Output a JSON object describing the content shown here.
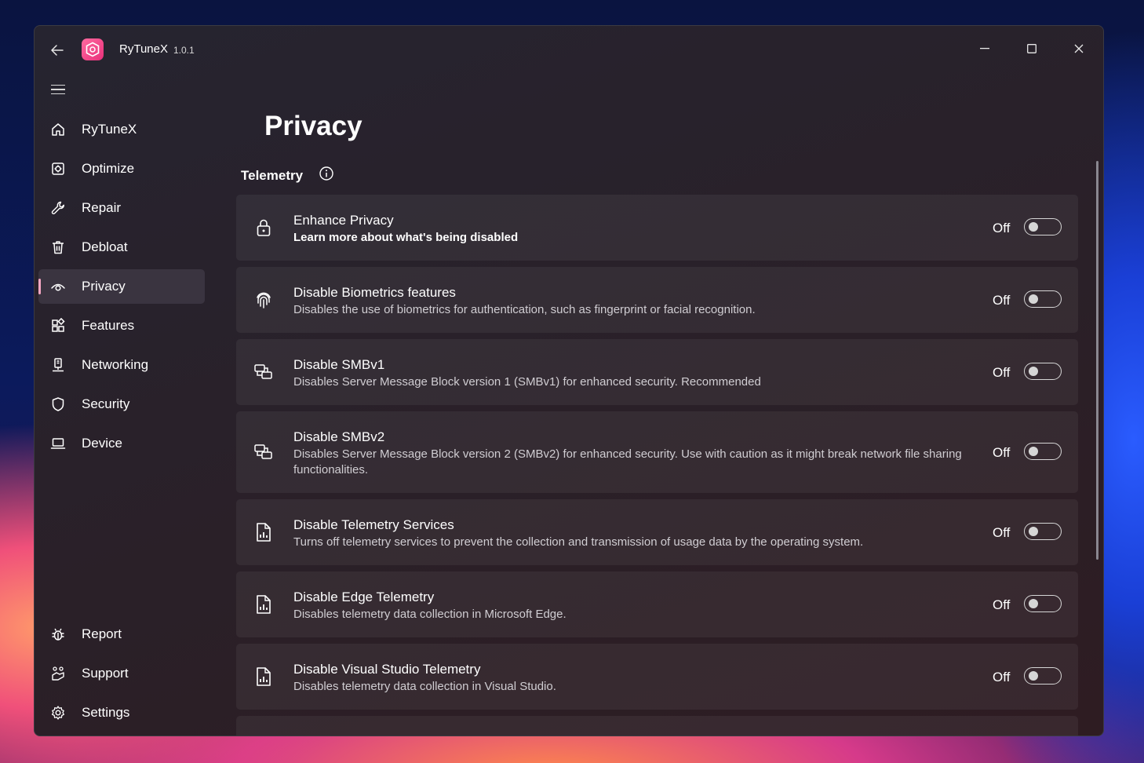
{
  "app": {
    "name": "RyTuneX",
    "version": "1.0.1"
  },
  "sidebar": {
    "items": [
      {
        "label": "RyTuneX",
        "icon": "home-icon"
      },
      {
        "label": "Optimize",
        "icon": "optimize-icon"
      },
      {
        "label": "Repair",
        "icon": "wrench-icon"
      },
      {
        "label": "Debloat",
        "icon": "trash-icon"
      },
      {
        "label": "Privacy",
        "icon": "eye-icon",
        "selected": true
      },
      {
        "label": "Features",
        "icon": "features-icon"
      },
      {
        "label": "Networking",
        "icon": "network-icon"
      },
      {
        "label": "Security",
        "icon": "shield-icon"
      },
      {
        "label": "Device",
        "icon": "laptop-icon"
      }
    ],
    "footer": [
      {
        "label": "Report",
        "icon": "bug-icon"
      },
      {
        "label": "Support",
        "icon": "support-icon"
      },
      {
        "label": "Settings",
        "icon": "gear-icon"
      }
    ]
  },
  "page": {
    "title": "Privacy",
    "section": "Telemetry"
  },
  "settings": [
    {
      "title": "Enhance Privacy",
      "desc": "Learn more about what's being disabled",
      "state": "Off",
      "icon": "lock-icon"
    },
    {
      "title": "Disable Biometrics features",
      "desc": "Disables the use of biometrics for authentication, such as fingerprint or facial recognition.",
      "state": "Off",
      "icon": "fingerprint-icon"
    },
    {
      "title": "Disable SMBv1",
      "desc": "Disables Server Message Block version 1 (SMBv1) for enhanced security. Recommended",
      "state": "Off",
      "icon": "smb-icon"
    },
    {
      "title": "Disable SMBv2",
      "desc": "Disables Server Message Block version 2 (SMBv2) for enhanced security. Use with caution as it might break network file sharing functionalities.",
      "state": "Off",
      "icon": "smb-icon"
    },
    {
      "title": "Disable Telemetry Services",
      "desc": "Turns off telemetry services to prevent the collection and transmission of usage data by the operating system.",
      "state": "Off",
      "icon": "report-doc-icon"
    },
    {
      "title": "Disable Edge Telemetry",
      "desc": "Disables telemetry data collection in Microsoft Edge.",
      "state": "Off",
      "icon": "report-doc-icon"
    },
    {
      "title": "Disable Visual Studio Telemetry",
      "desc": "Disables telemetry data collection in Visual Studio.",
      "state": "Off",
      "icon": "report-doc-icon"
    }
  ]
}
